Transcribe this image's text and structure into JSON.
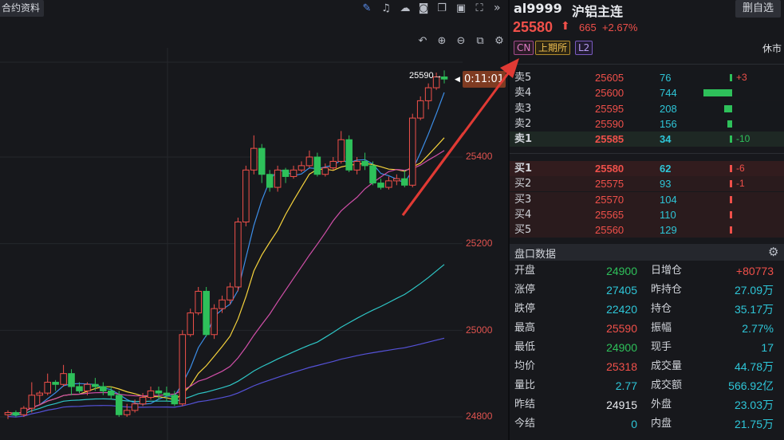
{
  "toolbar": {
    "contract_info": "合约资料",
    "icons": [
      "pencil-icon",
      "bell-icon",
      "cloud-icon",
      "camera-icon",
      "copy-icon",
      "screen-icon",
      "fullscreen-icon"
    ]
  },
  "chart": {
    "last_price_label": "25590→",
    "countdown": "0:11:01",
    "y_ticks": [
      "25400",
      "25200",
      "25000",
      "24800"
    ],
    "chart_data": {
      "type": "candlestick",
      "ylim": [
        24760,
        25630
      ],
      "yticks": [
        24800,
        25000,
        25200,
        25400
      ],
      "candles": [
        [
          24805,
          24810,
          24795,
          24815
        ],
        [
          24810,
          24805,
          24800,
          24815
        ],
        [
          24805,
          24820,
          24800,
          24825
        ],
        [
          24820,
          24850,
          24810,
          24880
        ],
        [
          24850,
          24855,
          24830,
          24860
        ],
        [
          24855,
          24880,
          24850,
          24900
        ],
        [
          24880,
          24875,
          24860,
          24885
        ],
        [
          24875,
          24900,
          24870,
          24920
        ],
        [
          24900,
          24870,
          24850,
          24910
        ],
        [
          24870,
          24860,
          24855,
          24880
        ],
        [
          24860,
          24875,
          24850,
          24880
        ],
        [
          24875,
          24870,
          24860,
          24890
        ],
        [
          24870,
          24860,
          24850,
          24880
        ],
        [
          24860,
          24850,
          24840,
          24870
        ],
        [
          24850,
          24805,
          24800,
          24860
        ],
        [
          24805,
          24815,
          24800,
          24830
        ],
        [
          24815,
          24830,
          24810,
          24840
        ],
        [
          24830,
          24845,
          24825,
          24855
        ],
        [
          24845,
          24860,
          24840,
          24870
        ],
        [
          24860,
          24855,
          24840,
          24870
        ],
        [
          24855,
          24850,
          24835,
          24870
        ],
        [
          24850,
          24830,
          24825,
          24860
        ],
        [
          24830,
          24990,
          24825,
          25000
        ],
        [
          24990,
          25040,
          24985,
          25050
        ],
        [
          25040,
          25090,
          25035,
          25100
        ],
        [
          25090,
          24990,
          24985,
          25100
        ],
        [
          24990,
          25050,
          24980,
          25060
        ],
        [
          25050,
          25070,
          25040,
          25080
        ],
        [
          25070,
          25100,
          25060,
          25110
        ],
        [
          25100,
          25250,
          25090,
          25260
        ],
        [
          25250,
          25370,
          25240,
          25380
        ],
        [
          25370,
          25420,
          25360,
          25450
        ],
        [
          25420,
          25360,
          25340,
          25430
        ],
        [
          25360,
          25330,
          25320,
          25370
        ],
        [
          25330,
          25370,
          25320,
          25380
        ],
        [
          25370,
          25355,
          25340,
          25375
        ],
        [
          25355,
          25370,
          25350,
          25380
        ],
        [
          25370,
          25380,
          25365,
          25390
        ],
        [
          25380,
          25400,
          25375,
          25415
        ],
        [
          25400,
          25360,
          25355,
          25410
        ],
        [
          25360,
          25375,
          25355,
          25385
        ],
        [
          25375,
          25390,
          25370,
          25400
        ],
        [
          25390,
          25440,
          25385,
          25460
        ],
        [
          25440,
          25370,
          25365,
          25450
        ],
        [
          25370,
          25390,
          25360,
          25400
        ],
        [
          25390,
          25380,
          25370,
          25410
        ],
        [
          25380,
          25340,
          25335,
          25390
        ],
        [
          25340,
          25330,
          25325,
          25350
        ],
        [
          25330,
          25345,
          25325,
          25355
        ],
        [
          25345,
          25350,
          25335,
          25360
        ],
        [
          25350,
          25335,
          25330,
          25370
        ],
        [
          25335,
          25490,
          25330,
          25500
        ],
        [
          25490,
          25530,
          25485,
          25540
        ],
        [
          25530,
          25560,
          25510,
          25570
        ],
        [
          25560,
          25585,
          25555,
          25595
        ],
        [
          25585,
          25580,
          25570,
          25600
        ]
      ]
    }
  },
  "side": {
    "code": "al9999",
    "name": "沪铝主连",
    "delete_label": "删自选",
    "price": "25580",
    "change": "665",
    "change_pct": "+2.67%",
    "tags": [
      "CN",
      "上期所",
      "L2"
    ],
    "status": "休市",
    "asks": [
      {
        "label": "卖5",
        "price": "25605",
        "vol": "76",
        "delta": "+3",
        "bar": 0.03
      },
      {
        "label": "卖4",
        "price": "25600",
        "vol": "744",
        "delta": "",
        "bar": 1.0
      },
      {
        "label": "卖3",
        "price": "25595",
        "vol": "208",
        "delta": "",
        "bar": 0.28
      },
      {
        "label": "卖2",
        "price": "25590",
        "vol": "156",
        "delta": "",
        "bar": 0.18
      },
      {
        "label": "卖1",
        "price": "25585",
        "vol": "34",
        "delta": "-10",
        "bar": 0.03
      }
    ],
    "bids": [
      {
        "label": "买1",
        "price": "25580",
        "vol": "62",
        "delta": "-6",
        "bar": 0.06
      },
      {
        "label": "买2",
        "price": "25575",
        "vol": "93",
        "delta": "-1",
        "bar": 0.06
      },
      {
        "label": "买3",
        "price": "25570",
        "vol": "104",
        "delta": "",
        "bar": 0.08
      },
      {
        "label": "买4",
        "price": "25565",
        "vol": "110",
        "delta": "",
        "bar": 0.08
      },
      {
        "label": "买5",
        "price": "25560",
        "vol": "129",
        "delta": "",
        "bar": 0.08
      }
    ],
    "panel_title": "盘口数据",
    "stats": [
      {
        "l1": "开盘",
        "v1": "24900",
        "c1": "#2ec05a",
        "l2": "日增仓",
        "v2": "+80773",
        "c2": "#f0504a"
      },
      {
        "l1": "涨停",
        "v1": "27405",
        "c1": "#2ec6d8",
        "l2": "昨持仓",
        "v2": "27.09万",
        "c2": "#2ec6d8"
      },
      {
        "l1": "跌停",
        "v1": "22420",
        "c1": "#2ec6d8",
        "l2": "持仓",
        "v2": "35.17万",
        "c2": "#2ec6d8"
      },
      {
        "l1": "最高",
        "v1": "25590",
        "c1": "#f0504a",
        "l2": "振幅",
        "v2": "2.77%",
        "c2": "#2ec6d8"
      },
      {
        "l1": "最低",
        "v1": "24900",
        "c1": "#2ec05a",
        "l2": "现手",
        "v2": "17",
        "c2": "#2ec6d8"
      },
      {
        "l1": "均价",
        "v1": "25318",
        "c1": "#f0504a",
        "l2": "成交量",
        "v2": "44.78万",
        "c2": "#2ec6d8"
      },
      {
        "l1": "量比",
        "v1": "2.77",
        "c1": "#2ec6d8",
        "l2": "成交额",
        "v2": "566.92亿",
        "c2": "#2ec6d8"
      },
      {
        "l1": "昨结",
        "v1": "24915",
        "c1": "#e8eaee",
        "l2": "外盘",
        "v2": "23.03万",
        "c2": "#2ec6d8"
      },
      {
        "l1": "今结",
        "v1": "0",
        "c1": "#2ec6d8",
        "l2": "内盘",
        "v2": "21.75万",
        "c2": "#2ec6d8"
      }
    ]
  },
  "colors": {
    "up": "#f0504a",
    "down": "#2ec05a",
    "vol": "#2ec6d8",
    "arrow": "#e03a34"
  }
}
